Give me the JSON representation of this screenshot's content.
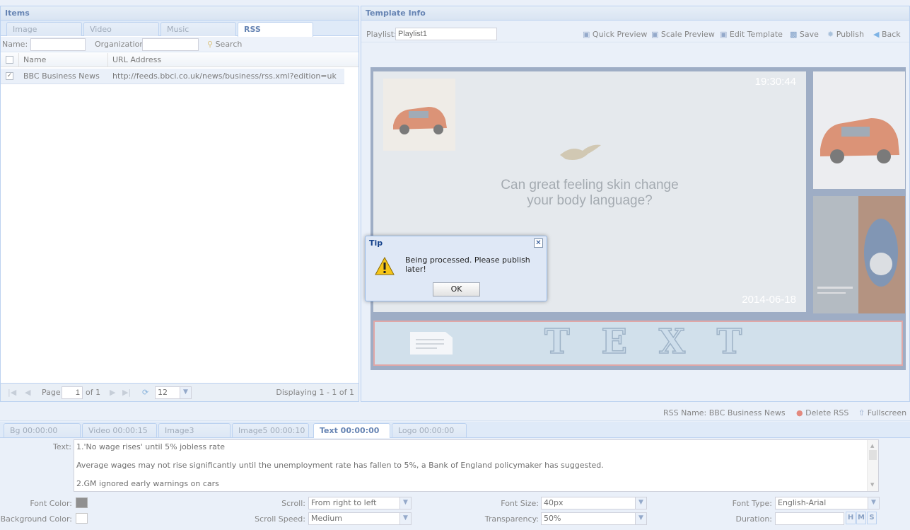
{
  "items_panel": {
    "title": "Items",
    "tabs": [
      "Image",
      "Video",
      "Music",
      "RSS"
    ],
    "search": {
      "name_label": "Name:",
      "name_value": "",
      "org_label": "Organization:",
      "org_value": "",
      "search_label": "Search"
    },
    "grid": {
      "columns": [
        "Name",
        "URL Address"
      ],
      "rows": [
        {
          "name": "BBC Business News",
          "url": "http://feeds.bbci.co.uk/news/business/rss.xml?edition=uk",
          "checked": true
        }
      ]
    },
    "paging": {
      "page_label": "Page",
      "page_value": "1",
      "of_label": "of 1",
      "page_size": "12",
      "status": "Displaying 1 - 1 of 1"
    }
  },
  "template_panel": {
    "title": "Template Info",
    "playlist_label": "Playlist:",
    "playlist_value": "Playlist1",
    "toolbar": [
      "Quick Preview",
      "Scale Preview",
      "Edit Template",
      "Save",
      "Publish",
      "Back"
    ],
    "preview": {
      "time": "19:30:44",
      "date": "2014-06-18",
      "headline_line1": "Can great feeling skin change",
      "headline_line2": "your body language?",
      "text_banner": "T E X T"
    }
  },
  "dialog": {
    "title": "Tip",
    "message": "Being processed. Please publish later!",
    "ok": "OK"
  },
  "bottom_toolbar": {
    "rss_name": "RSS Name: BBC Business News",
    "delete": "Delete RSS",
    "fullscreen": "Fullscreen"
  },
  "region_tabs": [
    "Bg 00:00:00",
    "Video 00:00:15",
    "Image3 00:00:20",
    "Image5 00:00:10",
    "Text 00:00:00",
    "Logo 00:00:00"
  ],
  "text_form": {
    "text_label": "Text:",
    "text_lines": [
      "1.'No wage rises' until 5% jobless rate",
      "Average wages may not rise significantly until the unemployment rate has fallen to 5%, a Bank of England policymaker has suggested.",
      "2.GM ignored early warnings on cars"
    ],
    "font_color_label": "Font Color:",
    "bg_color_label": "Background Color:",
    "scroll_label": "Scroll:",
    "scroll_value": "From right to left",
    "scroll_speed_label": "Scroll Speed:",
    "scroll_speed_value": "Medium",
    "font_size_label": "Font Size:",
    "font_size_value": "40px",
    "transparency_label": "Transparency:",
    "transparency_value": "50%",
    "font_type_label": "Font Type:",
    "font_type_value": "English-Arial",
    "duration_label": "Duration:",
    "duration_value": "",
    "duration_units": [
      "H",
      "M",
      "S"
    ]
  },
  "colors": {
    "font_color": "#555555",
    "bg_color": "#ffffff",
    "accent": "#15428b"
  }
}
